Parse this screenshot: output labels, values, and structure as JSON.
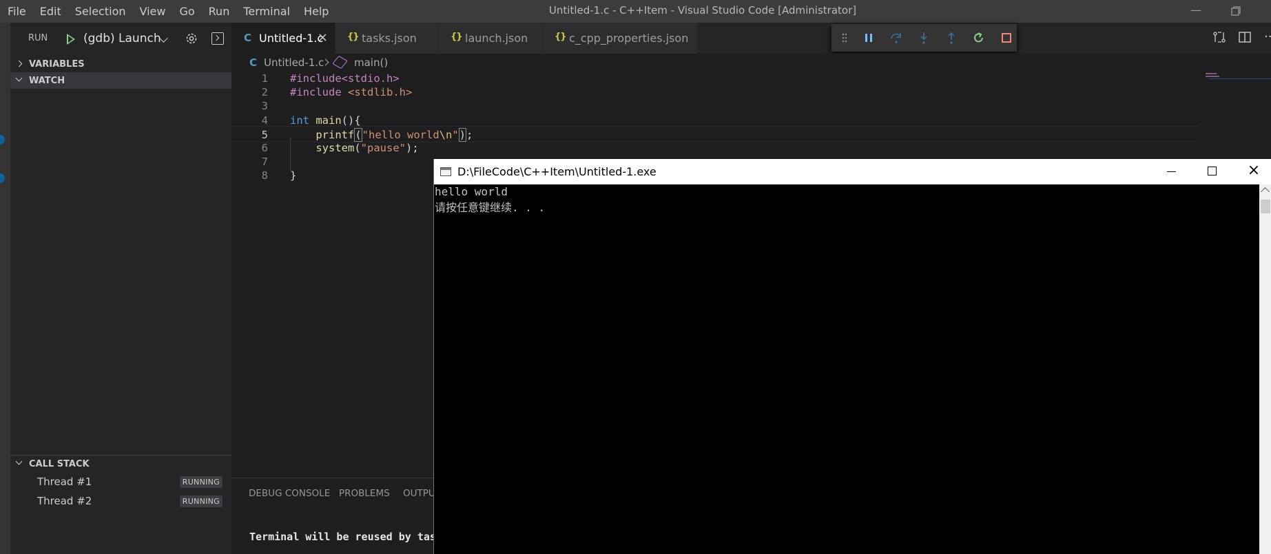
{
  "titlebar": {
    "menu": [
      "File",
      "Edit",
      "Selection",
      "View",
      "Go",
      "Run",
      "Terminal",
      "Help"
    ],
    "title": "Untitled-1.c - C++Item - Visual Studio Code [Administrator]"
  },
  "sidebar": {
    "run_label": "RUN",
    "launch_config": "(gdb) Launch",
    "variables_header": "VARIABLES",
    "watch_header": "WATCH",
    "callstack_header": "CALL STACK",
    "threads": [
      {
        "name": "Thread #1",
        "status": "RUNNING"
      },
      {
        "name": "Thread #2",
        "status": "RUNNING"
      }
    ]
  },
  "tabs": [
    {
      "label": "Untitled-1.c",
      "icon": "C"
    },
    {
      "label": "tasks.json",
      "icon": "{}"
    },
    {
      "label": "launch.json",
      "icon": "{}"
    },
    {
      "label": "c_cpp_properties.json",
      "icon": "{}"
    }
  ],
  "breadcrumbs": {
    "file": "Untitled-1.c",
    "symbol": "main()"
  },
  "editor": {
    "line_numbers": [
      "1",
      "2",
      "3",
      "4",
      "5",
      "6",
      "7",
      "8"
    ],
    "lines": [
      [
        {
          "t": "#include<stdio.h>",
          "c": "kw-pre"
        }
      ],
      [
        {
          "t": "#include ",
          "c": "kw-pre"
        },
        {
          "t": "<stdlib.h>",
          "c": "kw-str"
        }
      ],
      [],
      [
        {
          "t": "int",
          "c": "kw-type"
        },
        {
          "t": " ",
          "c": ""
        },
        {
          "t": "main",
          "c": "kw-fn"
        },
        {
          "t": "(){",
          "c": ""
        }
      ],
      [
        {
          "t": "    ",
          "c": ""
        },
        {
          "t": "printf",
          "c": "kw-fn"
        },
        {
          "t": "(",
          "c": "bracket-box"
        },
        {
          "t": "\"hello world",
          "c": "kw-str"
        },
        {
          "t": "\\n",
          "c": "kw-esc"
        },
        {
          "t": "\"",
          "c": "kw-str"
        },
        {
          "t": ")",
          "c": "bracket-box"
        },
        {
          "t": ";",
          "c": ""
        }
      ],
      [
        {
          "t": "    ",
          "c": ""
        },
        {
          "t": "system",
          "c": "kw-fn"
        },
        {
          "t": "(",
          "c": ""
        },
        {
          "t": "\"pause\"",
          "c": "kw-str"
        },
        {
          "t": ");",
          "c": ""
        }
      ],
      [],
      [
        {
          "t": "}",
          "c": ""
        }
      ]
    ]
  },
  "panel": {
    "tabs": [
      "DEBUG CONSOLE",
      "PROBLEMS",
      "OUTPU"
    ],
    "terminal_text": "Terminal will be reused by tas"
  },
  "console_window": {
    "title": "D:\\FileCode\\C++Item\\Untitled-1.exe",
    "output": [
      "hello world",
      "请按任意键继续. . ."
    ]
  },
  "colors": {
    "accent": "#0e639c",
    "debug_continue": "#75beff",
    "debug_restart": "#89d185",
    "debug_stop": "#f48771"
  }
}
